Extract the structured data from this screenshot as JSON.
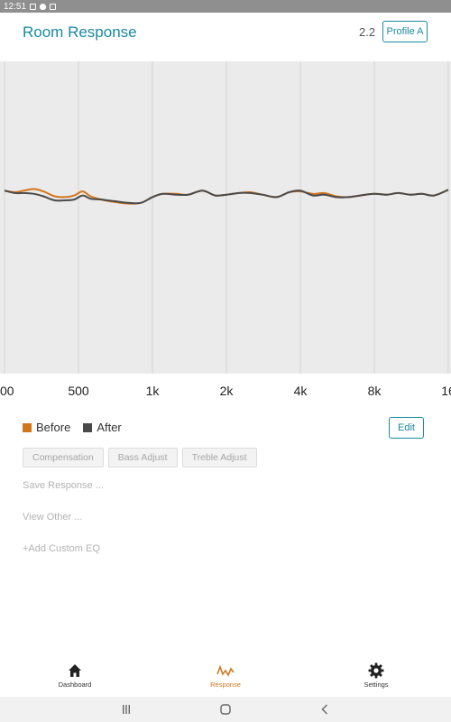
{
  "status_bar": {
    "time": "12:51"
  },
  "header": {
    "title": "Room Response",
    "version": "2.2",
    "profile_button": "Profile A"
  },
  "chart_data": {
    "type": "line",
    "xscale": "log",
    "xlim": [
      250,
      16000
    ],
    "x_ticks": [
      {
        "value": 250,
        "label": "00"
      },
      {
        "value": 500,
        "label": "500"
      },
      {
        "value": 1000,
        "label": "1k"
      },
      {
        "value": 2000,
        "label": "2k"
      },
      {
        "value": 4000,
        "label": "4k"
      },
      {
        "value": 8000,
        "label": "8k"
      },
      {
        "value": 16000,
        "label": "16"
      }
    ],
    "ylim": [
      -10,
      10
    ],
    "grid": "vertical",
    "series": [
      {
        "name": "Before",
        "color": "#d2761e",
        "x": [
          250,
          275,
          300,
          330,
          360,
          400,
          440,
          480,
          520,
          560,
          620,
          700,
          800,
          900,
          1000,
          1100,
          1250,
          1400,
          1600,
          1800,
          2000,
          2250,
          2500,
          2800,
          3200,
          3600,
          4000,
          4500,
          5000,
          5600,
          6300,
          7000,
          8000,
          9000,
          10000,
          11200,
          12500,
          14000,
          16000
        ],
        "values": [
          0.2,
          0.0,
          0.2,
          0.4,
          0.1,
          -0.5,
          -0.6,
          -0.4,
          0.1,
          -0.5,
          -0.9,
          -1.2,
          -1.4,
          -1.3,
          -0.6,
          -0.2,
          -0.2,
          -0.3,
          0.2,
          -0.4,
          -0.3,
          -0.1,
          0.0,
          -0.3,
          -0.6,
          0.0,
          0.1,
          -0.2,
          -0.1,
          -0.5,
          -0.6,
          -0.4,
          -0.2,
          -0.3,
          -0.1,
          -0.3,
          -0.2,
          -0.4,
          0.3
        ]
      },
      {
        "name": "After",
        "color": "#4a4a4a",
        "x": [
          250,
          275,
          300,
          330,
          360,
          400,
          440,
          480,
          520,
          560,
          620,
          700,
          800,
          900,
          1000,
          1100,
          1250,
          1400,
          1600,
          1800,
          2000,
          2250,
          2500,
          2800,
          3200,
          3600,
          4000,
          4500,
          5000,
          5600,
          6300,
          7000,
          8000,
          9000,
          10000,
          11200,
          12500,
          14000,
          16000
        ],
        "values": [
          0.2,
          -0.1,
          -0.1,
          -0.2,
          -0.5,
          -1.0,
          -1.0,
          -0.9,
          -0.4,
          -0.8,
          -0.9,
          -1.1,
          -1.3,
          -1.3,
          -0.6,
          -0.2,
          -0.3,
          -0.3,
          0.2,
          -0.4,
          -0.3,
          -0.1,
          -0.1,
          -0.3,
          -0.6,
          0.0,
          0.2,
          -0.4,
          -0.3,
          -0.6,
          -0.6,
          -0.4,
          -0.2,
          -0.3,
          -0.1,
          -0.3,
          -0.2,
          -0.4,
          0.3
        ]
      }
    ]
  },
  "legend": [
    {
      "label": "Before",
      "color": "#d2761e"
    },
    {
      "label": "After",
      "color": "#4a4a4a"
    }
  ],
  "edit_button": "Edit",
  "chips": [
    "Compensation",
    "Bass Adjust",
    "Treble Adjust"
  ],
  "menu": {
    "save": "Save Response ...",
    "view": "View Other ...",
    "add": "+Add Custom EQ"
  },
  "bottom_nav": [
    {
      "label": "Dashboard",
      "icon": "home-icon"
    },
    {
      "label": "Response",
      "icon": "waveform-icon"
    },
    {
      "label": "Settings",
      "icon": "gear-icon"
    }
  ],
  "colors": {
    "accent": "#1a8aa0",
    "active": "#d2761e",
    "plot_bg": "#ebebeb"
  }
}
